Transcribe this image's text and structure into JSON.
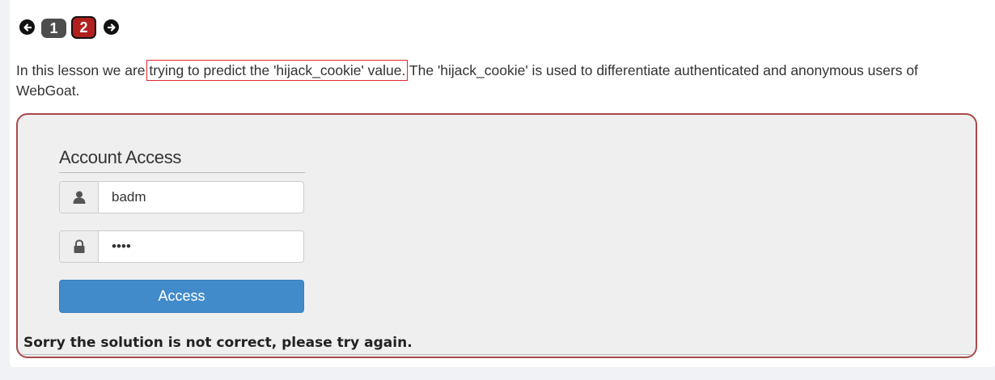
{
  "pager": {
    "pages": [
      "1",
      "2"
    ],
    "current": "2",
    "prev_icon": "arrow-left-circle-icon",
    "next_icon": "arrow-right-circle-icon"
  },
  "lesson": {
    "text_before": "In this lesson we are ",
    "text_highlight": "trying to predict the 'hijack_cookie' value.",
    "text_after": " The 'hijack_cookie' is used to differentiate authenticated and anonymous users of WebGoat."
  },
  "form": {
    "title": "Account Access",
    "username_value": "badm",
    "username_icon": "user-icon",
    "password_value": "••••",
    "password_icon": "lock-icon",
    "submit_label": "Access"
  },
  "feedback": {
    "message": "Sorry the solution is not correct, please try again."
  },
  "colors": {
    "page_active": "#b0201f",
    "page_inactive": "#4d4d4d",
    "button": "#428bca",
    "box_border": "#a94a4a",
    "highlight": "#e0262b"
  }
}
